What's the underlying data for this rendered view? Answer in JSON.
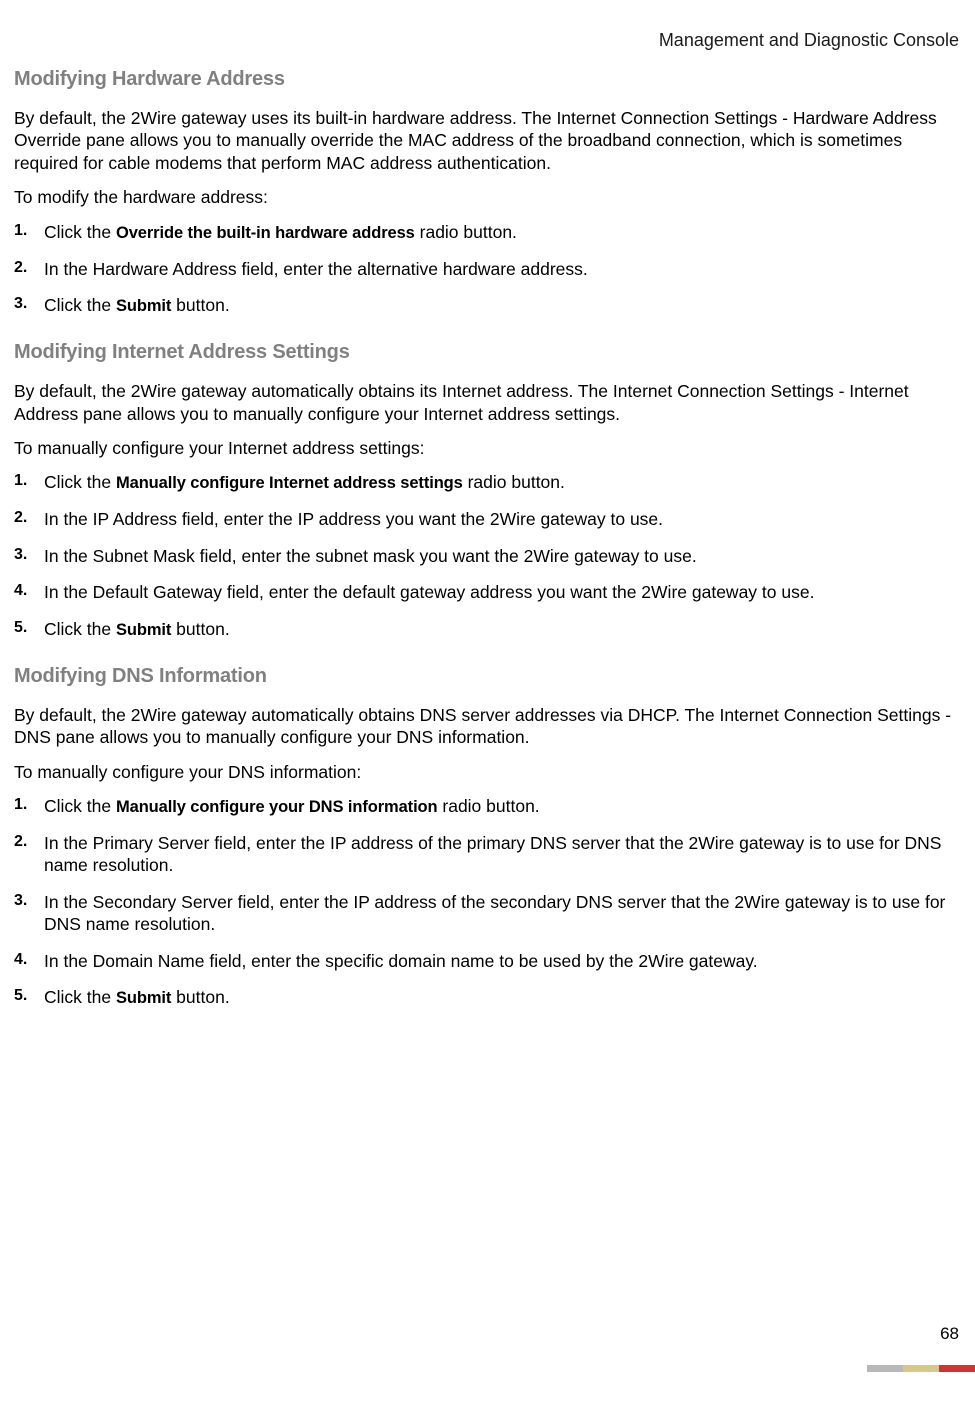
{
  "header": {
    "title": "Management and Diagnostic Console"
  },
  "page_number": "68",
  "sections": {
    "hw": {
      "heading": "Modifying Hardware Address",
      "intro": "By default, the 2Wire gateway uses its built-in hardware address. The Internet Connection Settings - Hardware Address Override pane allows you to manually override the MAC address of the broadband connection, which is sometimes required for cable modems that perform MAC address authentication.",
      "lead": "To modify the hardware address:",
      "step1_pre": "Click the ",
      "step1_bold": "Override the built-in hardware address",
      "step1_post": " radio button.",
      "step2": "In the Hardware Address field, enter the alternative hardware address.",
      "step3_pre": "Click the ",
      "step3_bold": "Submit",
      "step3_post": " button."
    },
    "inet": {
      "heading": "Modifying Internet Address Settings",
      "intro": "By default, the 2Wire gateway automatically obtains its Internet address. The Internet Connection Settings - Internet Address pane allows you to manually configure your Internet address settings.",
      "lead": "To manually configure your Internet address settings:",
      "step1_pre": "Click the ",
      "step1_bold": "Manually configure Internet address settings",
      "step1_post": " radio button.",
      "step2": "In the IP Address field, enter the IP address you want the 2Wire gateway to use.",
      "step3": "In the Subnet Mask field, enter the subnet mask you want the 2Wire gateway to use.",
      "step4": "In the Default Gateway field, enter the default gateway address you want the 2Wire gateway to use.",
      "step5_pre": "Click the ",
      "step5_bold": "Submit",
      "step5_post": " button."
    },
    "dns": {
      "heading": "Modifying DNS Information",
      "intro": "By default, the 2Wire gateway automatically obtains DNS server addresses via DHCP. The Internet Connection Settings - DNS pane allows you to manually configure your DNS information.",
      "lead": "To manually configure your DNS information:",
      "step1_pre": "Click the ",
      "step1_bold": "Manually configure your DNS information",
      "step1_post": " radio button.",
      "step2": "In the Primary Server field, enter the IP address of the primary DNS server that the 2Wire gateway is to use for DNS name resolution.",
      "step3": "In the Secondary Server field, enter the IP address of the secondary DNS server that the 2Wire gateway is to use for DNS name resolution.",
      "step4": "In the Domain Name field, enter the specific domain name to be used by the 2Wire gateway.",
      "step5_pre": "Click the ",
      "step5_bold": "Submit",
      "step5_post": " button."
    }
  }
}
